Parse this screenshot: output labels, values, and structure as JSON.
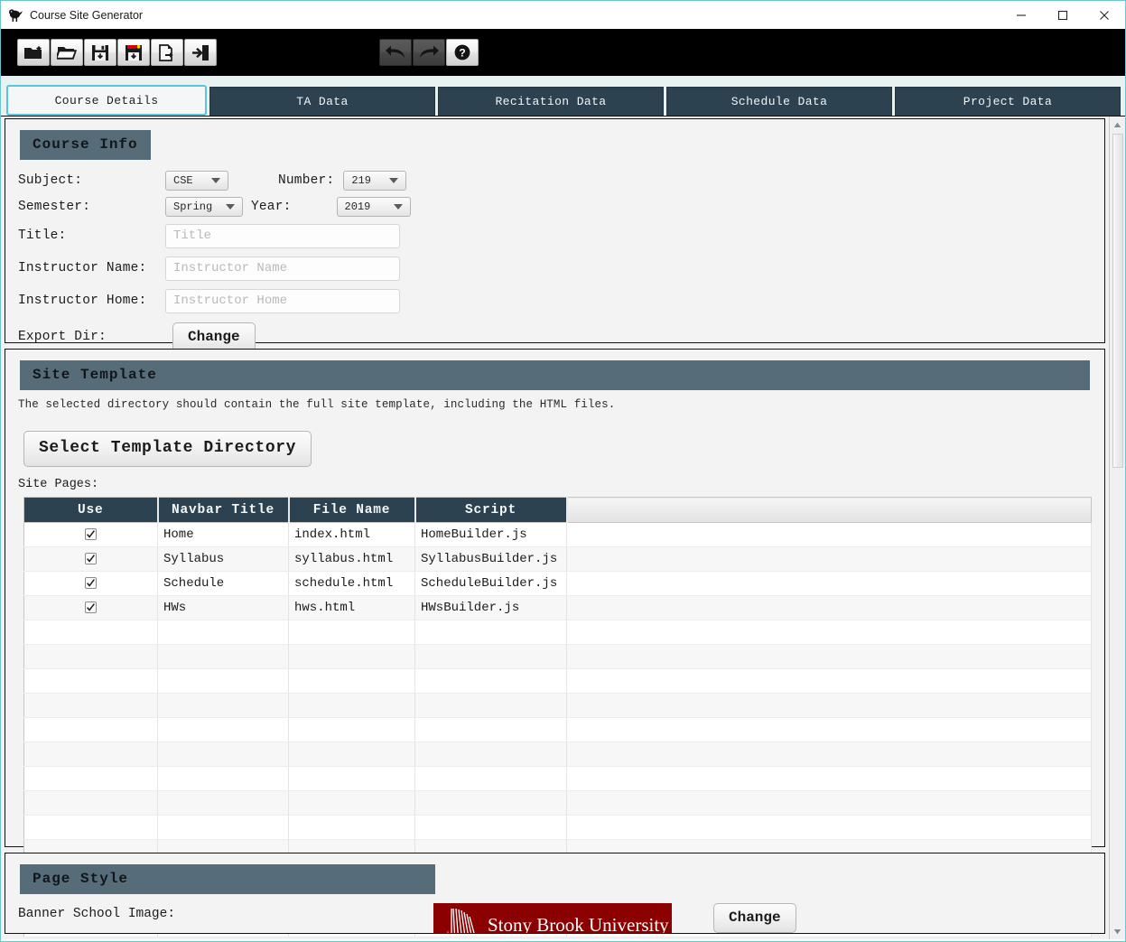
{
  "window": {
    "title": "Course Site Generator",
    "app_icon": "bird-icon",
    "frame_accent": "#6bc6cf",
    "controls": [
      {
        "name": "minimize",
        "glyph": "—"
      },
      {
        "name": "maximize",
        "glyph": "□"
      },
      {
        "name": "close",
        "glyph": "✕"
      }
    ]
  },
  "toolbar": {
    "background": "#000000",
    "left_buttons": [
      {
        "name": "new-course-button",
        "icon": "new-folder-icon",
        "enabled": true
      },
      {
        "name": "load-course-button",
        "icon": "open-folder-icon",
        "enabled": true
      },
      {
        "name": "save-course-button",
        "icon": "save-disk-icon",
        "enabled": true
      },
      {
        "name": "save-as-button",
        "icon": "save-as-disk-icon",
        "enabled": true
      },
      {
        "name": "export-site-button",
        "icon": "export-page-icon",
        "enabled": true
      },
      {
        "name": "exit-button",
        "icon": "exit-door-icon",
        "enabled": true
      }
    ],
    "right_buttons": [
      {
        "name": "undo-button",
        "icon": "undo-arrow-icon",
        "enabled": false
      },
      {
        "name": "redo-button",
        "icon": "redo-arrow-icon",
        "enabled": false
      },
      {
        "name": "help-button",
        "icon": "question-mark-icon",
        "enabled": true
      }
    ]
  },
  "tabs": {
    "active_index": 0,
    "items": [
      {
        "label": "Course Details"
      },
      {
        "label": "TA Data"
      },
      {
        "label": "Recitation Data"
      },
      {
        "label": "Schedule Data"
      },
      {
        "label": "Project Data"
      }
    ]
  },
  "course_info": {
    "header": "Course Info",
    "subject_label": "Subject:",
    "subject_value": "CSE",
    "number_label": "Number:",
    "number_value": "219",
    "semester_label": "Semester:",
    "semester_value": "Spring",
    "year_label": "Year:",
    "year_value": "2019",
    "title_label": "Title:",
    "title_value": "",
    "title_placeholder": "Title",
    "instructor_name_label": "Instructor Name:",
    "instructor_name_value": "",
    "instructor_name_placeholder": "Instructor Name",
    "instructor_home_label": "Instructor Home:",
    "instructor_home_value": "",
    "instructor_home_placeholder": "Instructor Home",
    "export_dir_label": "Export Dir:",
    "export_change_button": "Change"
  },
  "site_template": {
    "header": "Site Template",
    "hint": "The selected directory should contain the full site template, including the HTML files.",
    "select_dir_button": "Select Template Directory",
    "site_pages_label": "Site Pages:",
    "columns": [
      "Use",
      "Navbar Title",
      "File Name",
      "Script",
      ""
    ],
    "rows": [
      {
        "use": true,
        "navbar_title": "Home",
        "file_name": "index.html",
        "script": "HomeBuilder.js"
      },
      {
        "use": true,
        "navbar_title": "Syllabus",
        "file_name": "syllabus.html",
        "script": "SyllabusBuilder.js"
      },
      {
        "use": true,
        "navbar_title": "Schedule",
        "file_name": "schedule.html",
        "script": "ScheduleBuilder.js"
      },
      {
        "use": true,
        "navbar_title": "HWs",
        "file_name": "hws.html",
        "script": "HWsBuilder.js"
      }
    ],
    "empty_row_count": 13
  },
  "page_style": {
    "header": "Page Style",
    "banner_label": "Banner School Image:",
    "banner_image_text": "Stony Brook University",
    "banner_color": "#8b0000",
    "change_button": "Change"
  },
  "scrollbar": {
    "up_arrow": "scroll-up-arrow",
    "down_arrow": "scroll-down-arrow"
  }
}
